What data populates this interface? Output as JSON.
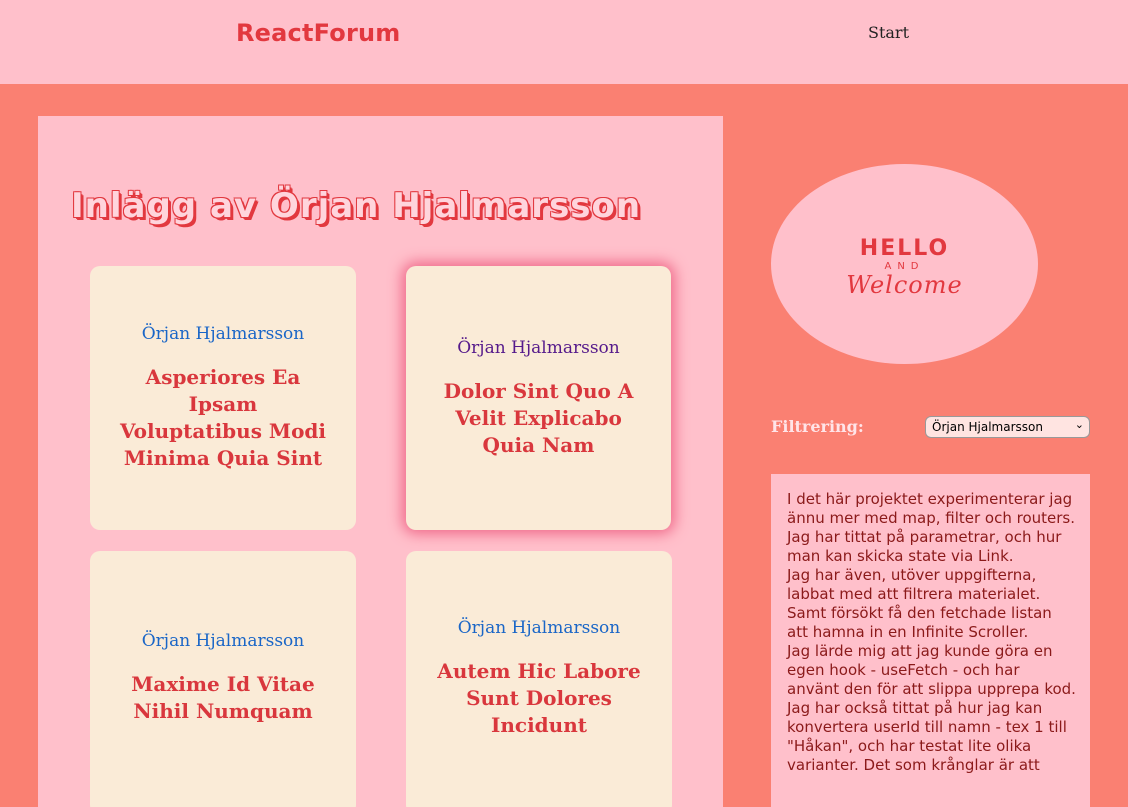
{
  "header": {
    "logo": "ReactForum",
    "nav_start": "Start"
  },
  "main": {
    "title": "Inlägg av Örjan Hjalmarsson",
    "posts": [
      {
        "author": "Örjan Hjalmarsson",
        "title": "Asperiores Ea Ipsam Voluptatibus Modi Minima Quia Sint"
      },
      {
        "author": "Örjan Hjalmarsson",
        "title": "Dolor Sint Quo A Velit Explicabo Quia Nam"
      },
      {
        "author": "Örjan Hjalmarsson",
        "title": "Maxime Id Vitae Nihil Numquam"
      },
      {
        "author": "Örjan Hjalmarsson",
        "title": "Autem Hic Labore Sunt Dolores Incidunt"
      }
    ]
  },
  "sidebar": {
    "welcome_hello": "HELLO",
    "welcome_and": "AND",
    "welcome_welcome": "Welcome",
    "filter_label": "Filtrering:",
    "filter_value": "Örjan Hjalmarsson",
    "info_paragraphs": [
      "I det här projektet experimenterar jag ännu mer med map, filter och routers.",
      "Jag har tittat på parametrar, och hur man kan skicka state via Link.",
      "Jag har även, utöver uppgifterna, labbat med att filtrera materialet.",
      "Samt försökt få den fetchade listan att hamna in en Infinite Scroller.",
      "Jag lärde mig att jag kunde göra en egen hook - useFetch - och har använt den för att slippa upprepa kod.",
      "Jag har också tittat på hur jag kan konvertera userId till namn - tex 1 till \"Håkan\", och har testat lite olika varianter. Det som krånglar är att"
    ]
  },
  "colors": {
    "background": "#fa8072",
    "panel": "#ffc0cb",
    "card": "#faebd7",
    "accent": "#e2383f"
  }
}
